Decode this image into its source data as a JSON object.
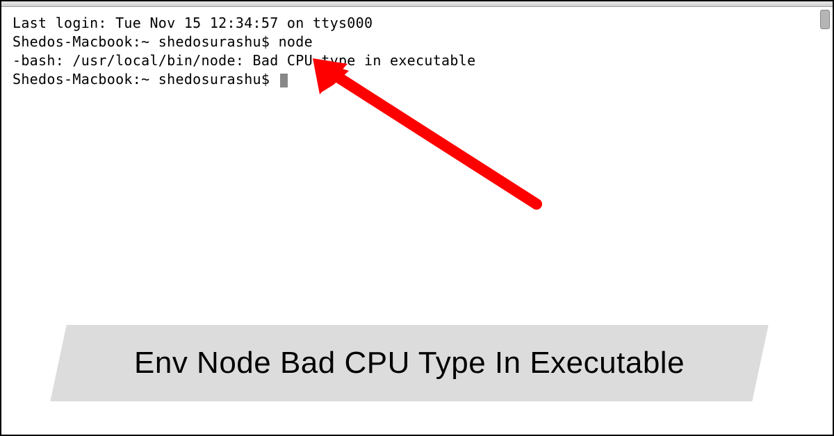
{
  "terminal": {
    "line1": "Last login: Tue Nov 15 12:34:57 on ttys000",
    "line2_prompt": "Shedos-Macbook:~ shedosurashu$ ",
    "line2_cmd": "node",
    "line3": "-bash: /usr/local/bin/node: Bad CPU type in executable",
    "line4_prompt": "Shedos-Macbook:~ shedosurashu$ "
  },
  "caption": "Env Node Bad CPU Type In Executable",
  "arrow": {
    "color": "#ff0000"
  }
}
